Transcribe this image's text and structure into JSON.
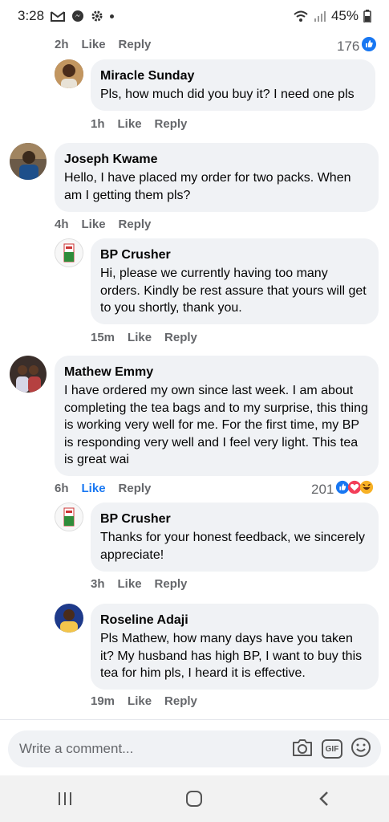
{
  "status_bar": {
    "time": "3:28",
    "battery": "45%"
  },
  "comments": [
    {
      "id": "c0",
      "time": "2h",
      "like_label": "Like",
      "reply_label": "Reply",
      "reaction_count": "176"
    },
    {
      "id": "r1",
      "author": "Miracle Sunday",
      "text": "Pls, how much did you buy it? I need one pls",
      "time": "1h",
      "like_label": "Like",
      "reply_label": "Reply"
    },
    {
      "id": "c2",
      "author": "Joseph Kwame",
      "text": "Hello, I have placed my order for two packs. When am I getting them pls?",
      "time": "4h",
      "like_label": "Like",
      "reply_label": "Reply"
    },
    {
      "id": "r2",
      "author": "BP Crusher",
      "text": "Hi, please we currently having too many orders. Kindly be rest assure that yours will get to you shortly,  thank you.",
      "time": "15m",
      "like_label": "Like",
      "reply_label": "Reply"
    },
    {
      "id": "c3",
      "author": "Mathew Emmy",
      "text": "I have ordered my own since last week. I am about completing the tea bags and to my surprise,  this thing is working very well for me. For the first time, my BP is responding very well and I feel very light. This tea is great wai",
      "time": "6h",
      "like_label": "Like",
      "reply_label": "Reply",
      "reaction_count": "201"
    },
    {
      "id": "r3",
      "author": "BP Crusher",
      "text": "Thanks for your honest feedback,  we sincerely appreciate!",
      "time": "3h",
      "like_label": "Like",
      "reply_label": "Reply"
    },
    {
      "id": "r4",
      "author": "Roseline Adaji",
      "text": "Pls Mathew, how many days have you taken it? My husband has high BP, I want to buy this tea for him pls, I heard it is effective.",
      "time": "19m",
      "like_label": "Like",
      "reply_label": "Reply"
    }
  ],
  "composer": {
    "placeholder": "Write a comment...",
    "gif_label": "GIF"
  },
  "colors": {
    "accent": "#1877f2",
    "bubble": "#f0f2f5",
    "meta_text": "#65676b",
    "love": "#f33e58",
    "haha": "#f7b125"
  }
}
